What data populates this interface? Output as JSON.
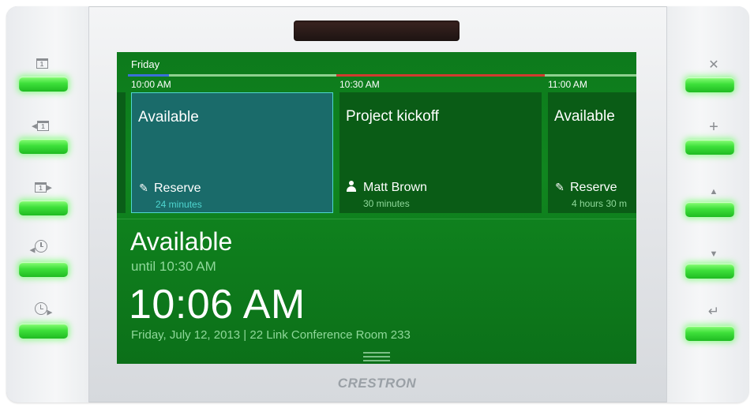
{
  "schedule": {
    "day": "Friday",
    "times": [
      "10:00 AM",
      "10:30 AM",
      "11:00 AM"
    ],
    "slots": [
      {
        "title": "Available",
        "action": "Reserve",
        "duration": "24 minutes",
        "icon": "pencil-icon"
      },
      {
        "title": "Project kickoff",
        "action": "Matt Brown",
        "duration": "30 minutes",
        "icon": "person-icon"
      },
      {
        "title": "Available",
        "action": "Reserve",
        "duration": "4 hours 30 m",
        "icon": "pencil-icon"
      }
    ]
  },
  "status": {
    "state": "Available",
    "until": "until 10:30 AM",
    "clock": "10:06 AM",
    "info": "Friday, July 12, 2013  |  22 Link Conference Room 233"
  },
  "brand": "CRESTRON",
  "hardware": {
    "left_icons": [
      "calendar-today-icon",
      "calendar-previous-icon",
      "calendar-next-icon",
      "clock-previous-icon",
      "clock-next-icon"
    ],
    "right_icons": [
      "close-icon",
      "plus-icon",
      "up-icon",
      "down-icon",
      "enter-icon"
    ],
    "led_color": "#3ee03a"
  },
  "colors": {
    "screen_green": "#10861f",
    "selected_slot": "#1a6b6a",
    "selected_border": "#4fd6d0",
    "accent_blue": "#3a6fd9",
    "accent_red": "#d23b2f",
    "subtle_text": "#8fd89a"
  }
}
